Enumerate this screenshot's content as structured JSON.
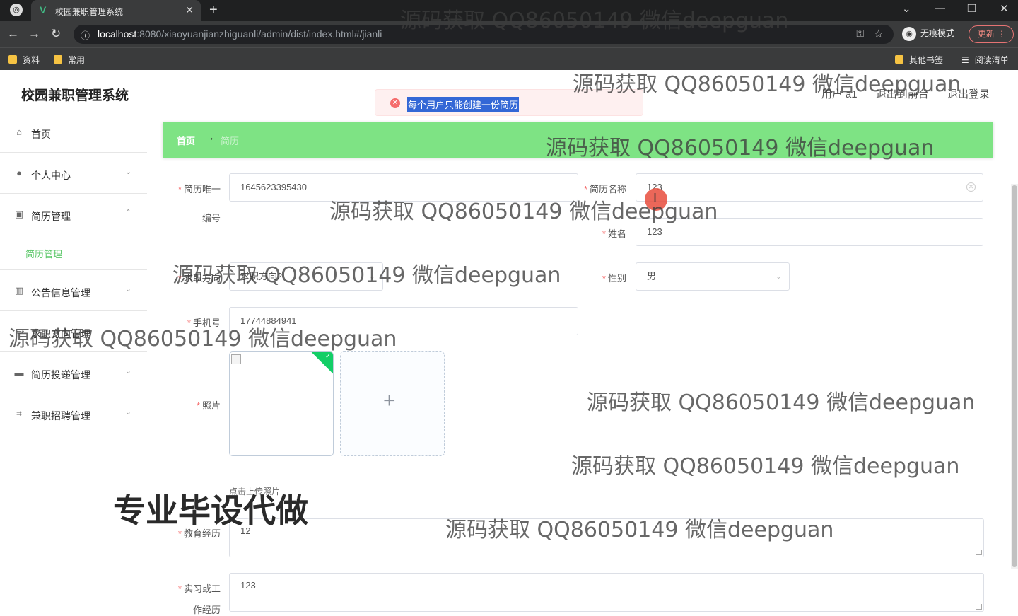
{
  "browser": {
    "tab_title": "校园兼职管理系统",
    "url_host": "localhost",
    "url_path": ":8080/xiaoyuanjianzhiguanli/admin/dist/index.html#/jianli",
    "incognito_label": "无痕模式",
    "update_label": "更新",
    "bookmarks": [
      "资料",
      "常用"
    ],
    "other_bookmarks": "其他书签",
    "reading_list": "阅读清单"
  },
  "app": {
    "title": "校园兼职管理系统",
    "user_label": "用户 a1",
    "back_to_front": "退出到前台",
    "logout": "退出登录"
  },
  "toast": {
    "message": "每个用户只能创建一份简历",
    "type": "error"
  },
  "sidebar": {
    "items": [
      {
        "label": "首页",
        "icon": "home-icon"
      },
      {
        "label": "个人中心",
        "icon": "user-icon"
      },
      {
        "label": "简历管理",
        "icon": "picture-icon"
      },
      {
        "label": "公告信息管理",
        "icon": "chart-icon"
      },
      {
        "label": "求职方向管理",
        "icon": "list-icon"
      },
      {
        "label": "简历投递管理",
        "icon": "message-icon"
      },
      {
        "label": "兼职招聘管理",
        "icon": "crop-icon"
      }
    ],
    "sub_item": "简历管理"
  },
  "breadcrumb": {
    "home": "首页",
    "separator": "→",
    "current": "简历"
  },
  "form": {
    "resume_id_label_1": "简历唯一",
    "resume_id_label_2": "编号",
    "resume_id_value": "1645623395430",
    "resume_name_label": "简历名称",
    "resume_name_value": "123",
    "name_label": "姓名",
    "name_value": "123",
    "direction_label": "求职方向",
    "direction_value": "求职方向2",
    "gender_label": "性别",
    "gender_value": "男",
    "phone_label": "手机号",
    "phone_value": "17744884941",
    "photo_label": "照片",
    "upload_hint": "点击上传照片",
    "education_label": "教育经历",
    "education_value": "12",
    "work_label_1": "实习或工",
    "work_label_2": "作经历",
    "work_value": "123"
  },
  "watermarks": {
    "text": "源码获取 QQ86050149 微信deepguan",
    "banner": "专业毕设代做"
  }
}
